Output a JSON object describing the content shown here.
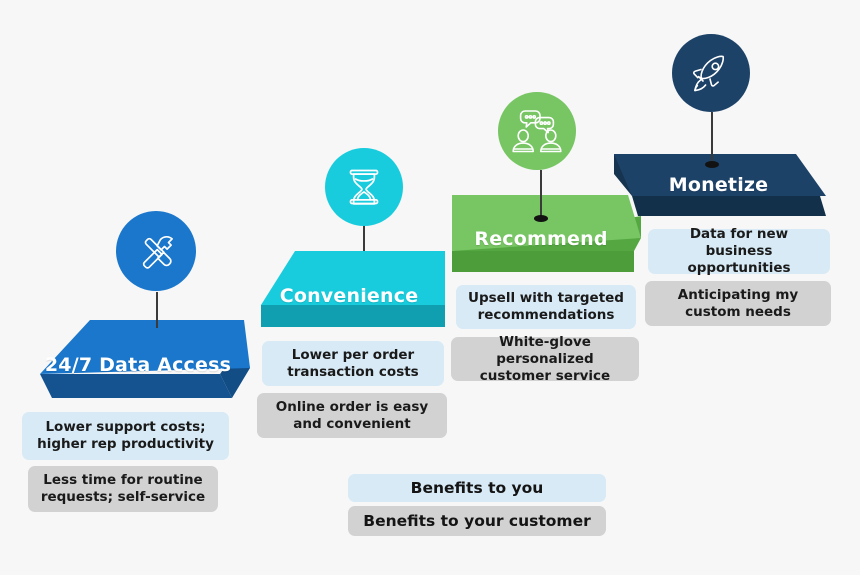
{
  "background_color": "#f7f7f7",
  "steps": [
    {
      "id": "data-access",
      "label": "24/7 Data Access",
      "icon_name": "tools-hammer-screwdriver-icon",
      "slab_color": "#1a77cc",
      "slab_side_color": "#155a9c",
      "slab_front_color": "#14538f",
      "badge_color": "#1a77cc",
      "benefit_you": "Lower support costs; higher rep productivity",
      "benefit_customer": "Less time for routine requests; self-service"
    },
    {
      "id": "convenience",
      "label": "Convenience",
      "icon_name": "hourglass-icon",
      "slab_color": "#18ccdd",
      "slab_side_color": "#10a9bb",
      "slab_front_color": "#0f9fb0",
      "badge_color": "#18ccdd",
      "benefit_you": "Lower per order transaction costs",
      "benefit_customer": "Online order is easy and convenient"
    },
    {
      "id": "recommend",
      "label": "Recommend",
      "icon_name": "people-speech-bubbles-icon",
      "slab_color": "#77c563",
      "slab_side_color": "#55a742",
      "slab_front_color": "#4d9e3b",
      "badge_color": "#77c563",
      "benefit_you": "Upsell with targeted recommendations",
      "benefit_customer": "White-glove personalized customer service"
    },
    {
      "id": "monetize",
      "label": "Monetize",
      "icon_name": "rocket-icon",
      "slab_color": "#1d4268",
      "slab_side_color": "#16344f",
      "slab_front_color": "#13304a",
      "badge_color": "#1d4268",
      "benefit_you": "Data for new business opportunities",
      "benefit_customer": "Anticipating my custom needs"
    }
  ],
  "legend": {
    "you_label": "Benefits to you",
    "customer_label": "Benefits to your customer",
    "you_color": "#d7eaf6",
    "customer_color": "#d2d2d2"
  }
}
